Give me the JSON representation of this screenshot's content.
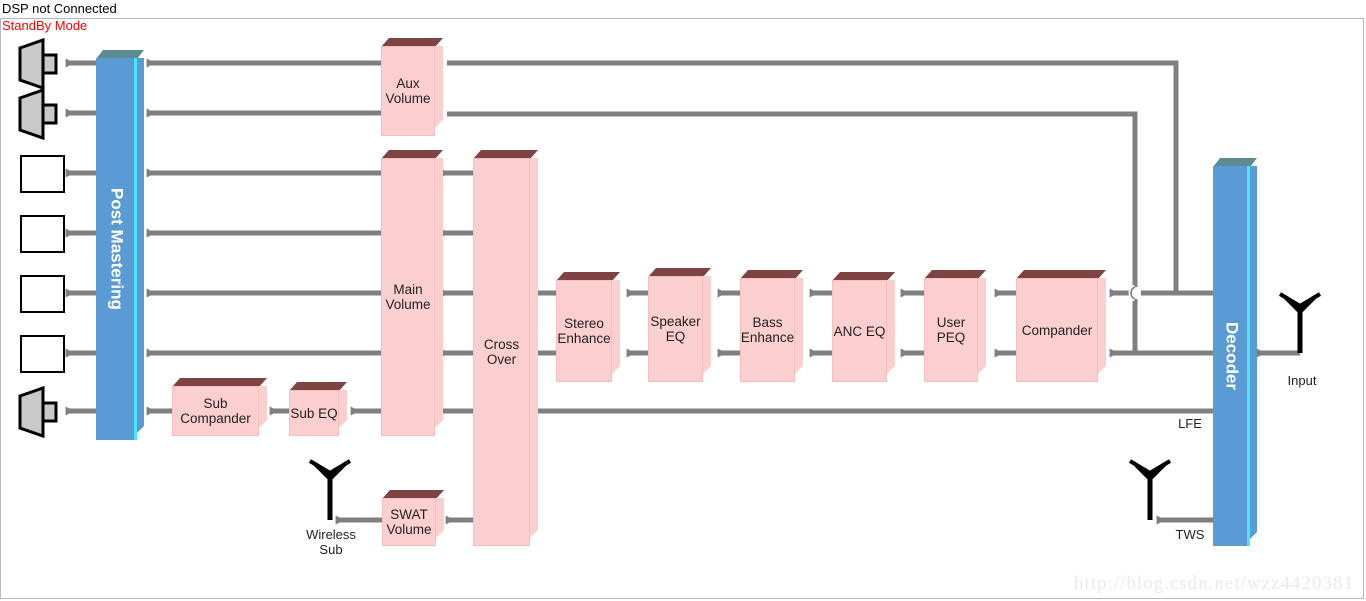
{
  "status": {
    "line1": "DSP not Connected",
    "line2": "StandBy Mode",
    "line1_color": "#000000",
    "line2_color": "#ff0000"
  },
  "watermark": "http://blog.csdn.net/wzz4420381",
  "colors": {
    "block_fill": "#fbcfcf",
    "block_top": "#7e4343",
    "blue_fill": "#5b9bd5",
    "blue_top": "#5d8b94",
    "blue_edge": "#46e8f5",
    "wire": "#7f7f7f",
    "text": "#231f20"
  },
  "blue_blocks": [
    {
      "id": "post-mastering",
      "label": "Post Mastering"
    },
    {
      "id": "decoder",
      "label": "Decoder"
    }
  ],
  "blocks": [
    {
      "id": "aux-volume",
      "label": "Aux\nVolume"
    },
    {
      "id": "main-volume",
      "label": "Main\nVolume"
    },
    {
      "id": "cross-over",
      "label": "Cross\nOver"
    },
    {
      "id": "stereo-enhance",
      "label": "Stereo\nEnhance"
    },
    {
      "id": "speaker-eq",
      "label": "Speaker\nEQ"
    },
    {
      "id": "bass-enhance",
      "label": "Bass\nEnhance"
    },
    {
      "id": "anc-eq",
      "label": "ANC  EQ"
    },
    {
      "id": "user-peq",
      "label": "User\nPEQ"
    },
    {
      "id": "compander",
      "label": "Compander"
    },
    {
      "id": "sub-compander",
      "label": "Sub\nCompander"
    },
    {
      "id": "sub-eq",
      "label": "Sub EQ"
    },
    {
      "id": "swat-volume",
      "label": "SWAT\nVolume"
    }
  ],
  "labels": {
    "input": "Input",
    "lfe": "LFE",
    "tws": "TWS",
    "wireless_sub": "Wireless\nSub"
  },
  "icons": [
    {
      "id": "speaker-out-1",
      "name": "speaker-icon"
    },
    {
      "id": "speaker-out-2",
      "name": "speaker-icon"
    },
    {
      "id": "digital-out-1",
      "name": "square-wave-icon"
    },
    {
      "id": "digital-out-2",
      "name": "square-wave-icon"
    },
    {
      "id": "digital-out-3",
      "name": "square-wave-icon"
    },
    {
      "id": "digital-out-4",
      "name": "square-wave-icon"
    },
    {
      "id": "speaker-sub",
      "name": "speaker-icon"
    },
    {
      "id": "antenna-input",
      "name": "antenna-icon"
    },
    {
      "id": "antenna-tws",
      "name": "antenna-icon"
    },
    {
      "id": "antenna-wsub",
      "name": "antenna-icon"
    }
  ]
}
